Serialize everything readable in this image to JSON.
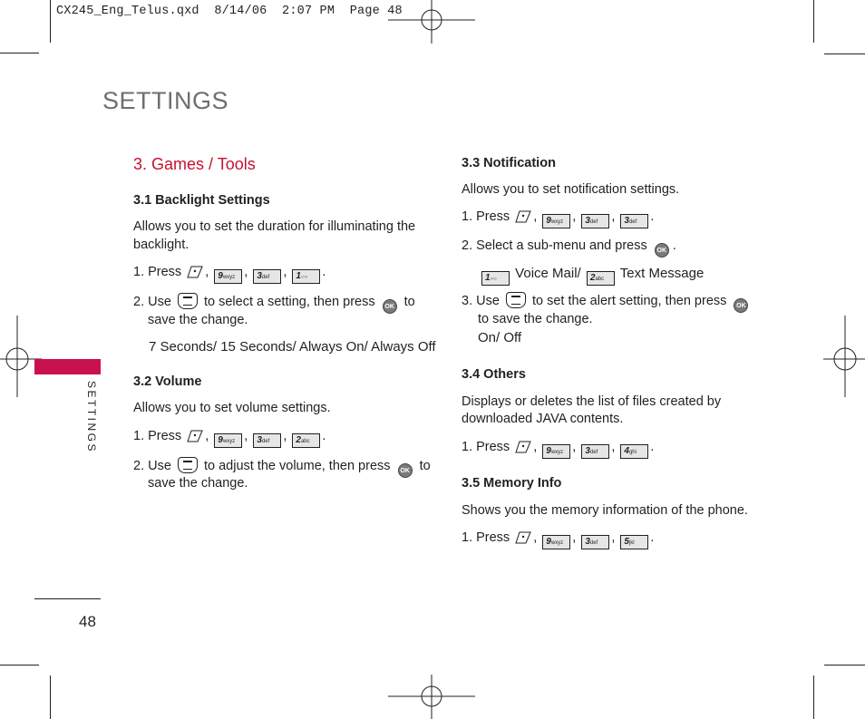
{
  "slug": "CX245_Eng_Telus.qxd  8/14/06  2:07 PM  Page 48",
  "page_title": "SETTINGS",
  "side_label": "SETTINGS",
  "page_number": "48",
  "accent_color": "#c8104f",
  "section": {
    "title": "3. Games / Tools"
  },
  "keys": {
    "soft": "menu-soft-key-icon",
    "k9": {
      "num": "9",
      "letters": "wxyz"
    },
    "k3": {
      "num": "3",
      "letters": "def"
    },
    "k1": {
      "num": "1",
      "letters": "vm"
    },
    "k2": {
      "num": "2",
      "letters": "abc"
    },
    "k4": {
      "num": "4",
      "letters": "ghi"
    },
    "k5": {
      "num": "5",
      "letters": "jkl"
    },
    "ok": "OK"
  },
  "s31": {
    "heading": "3.1 Backlight Settings",
    "desc_1": "Allows you to set the duration for illuminating the",
    "desc_2": "backlight.",
    "step1_prefix": "1. Press",
    "step2_prefix": "2. Use",
    "step2_mid": "to select a setting, then press",
    "step2_end": "to",
    "step2_line2": "save the change.",
    "options": "7 Seconds/ 15 Seconds/ Always On/ Always Off"
  },
  "s32": {
    "heading": "3.2 Volume",
    "desc": "Allows you to set volume settings.",
    "step1_prefix": "1. Press",
    "step2_prefix": "2. Use",
    "step2_mid": "to adjust the volume, then press",
    "step2_end": "to",
    "step2_line2": "save the change."
  },
  "s33": {
    "heading": "3.3 Notification",
    "desc": "Allows you to set notification settings.",
    "step1_prefix": "1. Press",
    "step2": "2. Select a sub-menu and press",
    "sub1": "Voice Mail/",
    "sub2": "Text Message",
    "step3_prefix": "3. Use",
    "step3_mid": "to set the alert setting, then press",
    "step3_line2": "to save the change.",
    "options": "On/ Off"
  },
  "s34": {
    "heading": "3.4 Others",
    "desc_1": "Displays or deletes the list of files created by",
    "desc_2": "downloaded JAVA contents.",
    "step1_prefix": "1. Press"
  },
  "s35": {
    "heading": "3.5 Memory Info",
    "desc": "Shows you the memory information of the phone.",
    "step1_prefix": "1. Press"
  }
}
